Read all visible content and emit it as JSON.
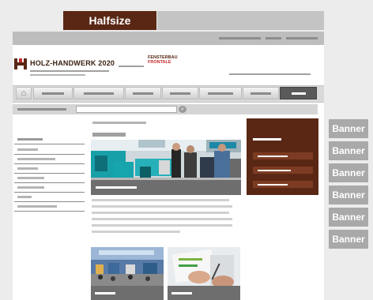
{
  "header": {
    "halfsize_label": "Halfsize",
    "logo_text": "HOLZ-HANDWERK 2020",
    "partner_logo_line1": "FENSTERBAU",
    "partner_logo_line2": "FRONTALE"
  },
  "navigation": {
    "home_icon": "home-icon",
    "item_count": 7
  },
  "search": {
    "icon": "search-icon"
  },
  "banners": [
    "Banner",
    "Banner",
    "Banner",
    "Banner",
    "Banner",
    "Banner"
  ],
  "colors": {
    "brand": "#5a2715",
    "accent_red": "#c62828",
    "banner_gray": "#a9a9a9",
    "caption_gray": "#6e6e6e"
  }
}
